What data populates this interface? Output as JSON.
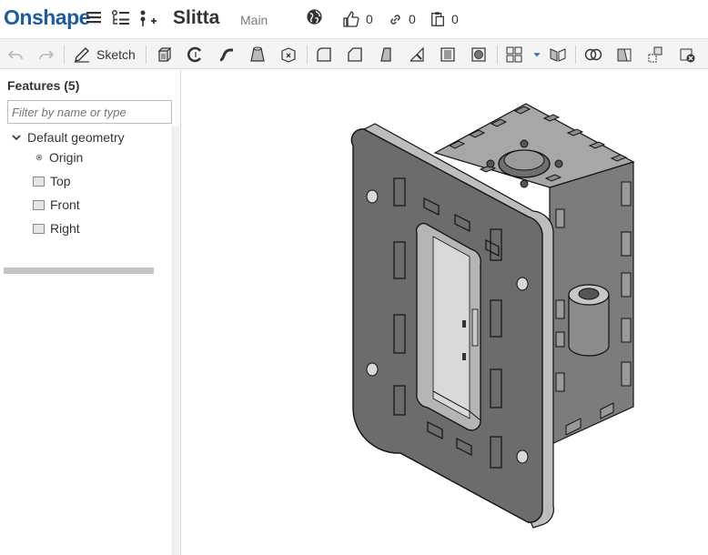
{
  "header": {
    "logo": "Onshape",
    "document_title": "Slitta",
    "branch": "Main",
    "likes": "0",
    "links": "0",
    "copies": "0"
  },
  "toolbar": {
    "sketch_label": "Sketch"
  },
  "feature_panel": {
    "title": "Features (5)",
    "filter_placeholder": "Filter by name or type",
    "tree": {
      "group_label": "Default geometry",
      "items": [
        {
          "label": "Origin"
        },
        {
          "label": "Top"
        },
        {
          "label": "Front"
        },
        {
          "label": "Right"
        }
      ]
    }
  },
  "colors": {
    "brand": "#1c5c9e",
    "model_dark": "#5f5f5f",
    "model_mid": "#777777",
    "model_light": "#a3a3a3",
    "toolbar_bg": "#f4f4f4"
  }
}
